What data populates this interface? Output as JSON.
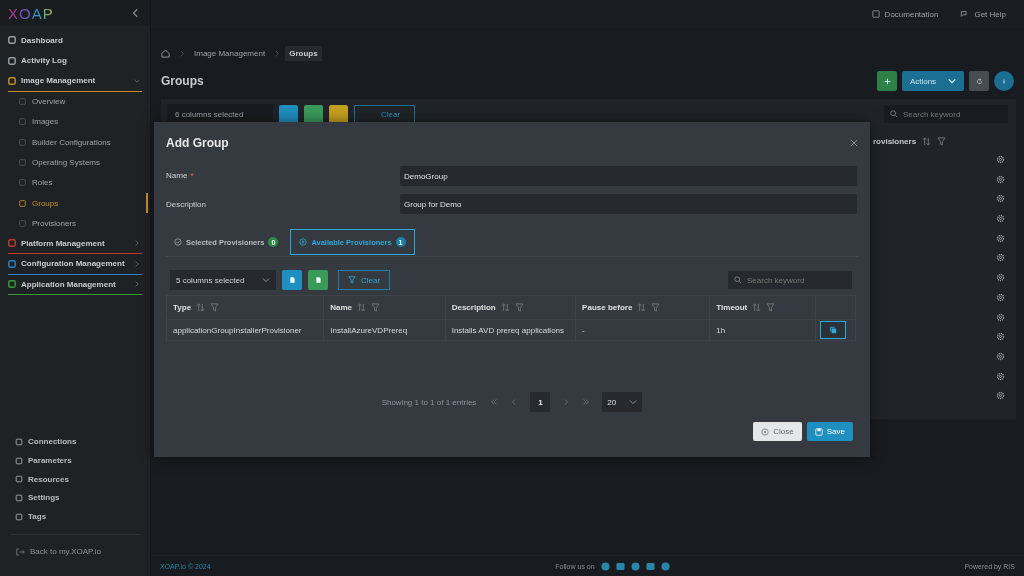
{
  "sidebar": {
    "logo": "XOAP",
    "items": [
      {
        "label": "Dashboard",
        "selected": false,
        "color": "#9aa0a6"
      },
      {
        "label": "Activity Log",
        "selected": false,
        "color": "#9aa0a6"
      },
      {
        "label": "Image Management",
        "selected": false,
        "expanded": true,
        "color": "#c8902a",
        "children": [
          {
            "label": "Overview",
            "selected": false
          },
          {
            "label": "Images",
            "selected": false
          },
          {
            "label": "Builder Configurations",
            "selected": false
          },
          {
            "label": "Operating Systems",
            "selected": false
          },
          {
            "label": "Roles",
            "selected": false
          },
          {
            "label": "Groups",
            "selected": true
          },
          {
            "label": "Provisioners",
            "selected": false
          }
        ]
      },
      {
        "label": "Platform Management",
        "selected": false,
        "expanded": false,
        "color": "#c0392b"
      },
      {
        "label": "Configuration Management",
        "selected": false,
        "expanded": false,
        "color": "#2e7fc4"
      },
      {
        "label": "Application Management",
        "selected": false,
        "expanded": false,
        "color": "#3a9a3a"
      }
    ],
    "bottom_items": [
      {
        "label": "Connections",
        "selected": false
      },
      {
        "label": "Parameters",
        "selected": false
      },
      {
        "label": "Resources",
        "selected": false
      },
      {
        "label": "Settings",
        "selected": false
      },
      {
        "label": "Tags",
        "selected": false
      }
    ],
    "back_link": "Back to my.XOAP.io"
  },
  "header": {
    "links": [
      "Documentation",
      "Get Help"
    ]
  },
  "breadcrumb": [
    "Image Management",
    "Groups"
  ],
  "page_title": "Groups",
  "toolbar": {
    "actions": "Actions"
  },
  "background_table": {
    "column_selector": "6 columns selected",
    "clear": "Clear",
    "search_placeholder": "Search keyword",
    "column": "rovisioners"
  },
  "modal": {
    "title": "Add Group",
    "fields": [
      {
        "label": "Name",
        "marker": "*",
        "value": "DemoGroup"
      },
      {
        "label": "Description",
        "value": "Group for Demo"
      }
    ],
    "tabs": [
      {
        "label": "Selected Provisioners",
        "count": "0",
        "selected": false,
        "kind": "selected"
      },
      {
        "label": "Available Provisioners",
        "count": "1",
        "selected": true,
        "kind": "available"
      }
    ],
    "column_selector": "5 columns selected",
    "clear": "Clear",
    "search_placeholder": "Search keyword",
    "columns": [
      "Type",
      "Name",
      "Description",
      "Pause before",
      "Timeout"
    ],
    "rows": [
      {
        "cells": [
          "applicationGroupInstallerProvisioner",
          "InstallAzureVDPrereq",
          "Installs AVD prereq applications",
          "-",
          "1h"
        ]
      }
    ],
    "pagination": {
      "info": "Showing 1 to 1 of 1 entries",
      "pages": [
        {
          "label": "1",
          "selected": true
        }
      ],
      "page_size": "20"
    },
    "buttons": {
      "close": "Close",
      "save": "Save"
    }
  },
  "footer": {
    "copyright": "XOAP.io © 2024",
    "follow": "Follow us on",
    "powered": "Powered by RIS"
  }
}
